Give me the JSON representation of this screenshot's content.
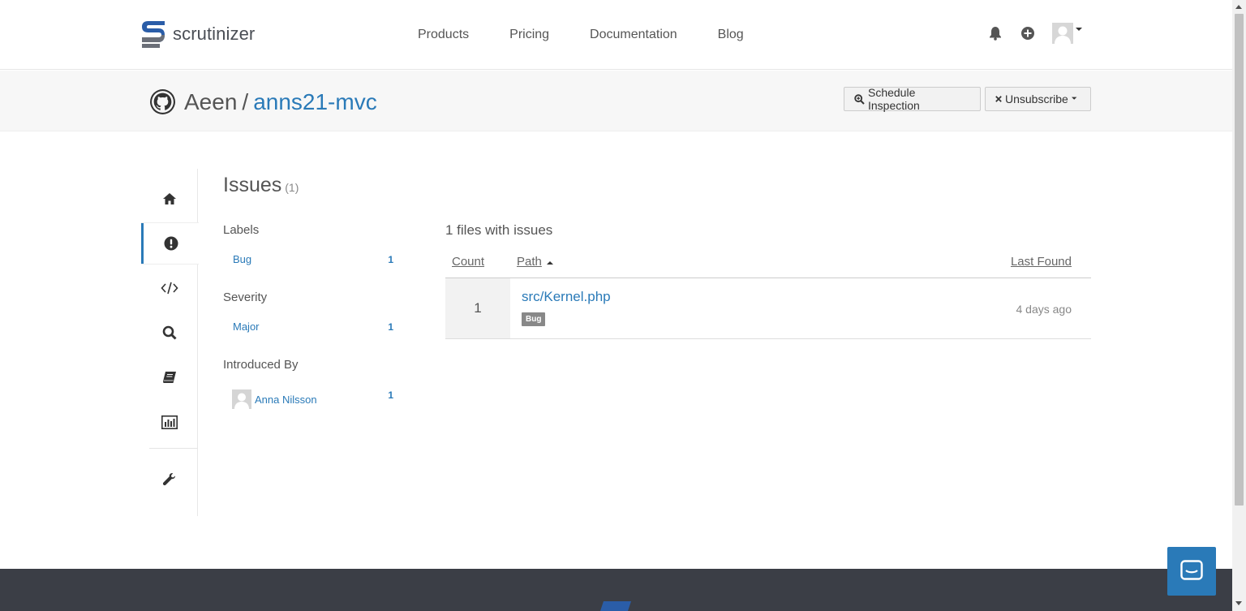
{
  "brand": {
    "name": "scrutinizer",
    "accent": "#2a7ab8"
  },
  "nav": {
    "items": [
      {
        "label": "Products"
      },
      {
        "label": "Pricing"
      },
      {
        "label": "Documentation"
      },
      {
        "label": "Blog"
      }
    ],
    "icons": [
      "bell-icon",
      "plus-circle-icon",
      "user-avatar"
    ]
  },
  "repo": {
    "owner": "Aeen",
    "separator": "/",
    "name": "anns21-mvc",
    "schedule_label": "Schedule Inspection",
    "unsubscribe_label": "Unsubscribe"
  },
  "sidebar": {
    "items": [
      "home-icon",
      "issues-icon",
      "code-icon",
      "search-icon",
      "book-icon",
      "chart-icon",
      "wrench-icon"
    ],
    "active": "issues-icon"
  },
  "issues": {
    "title": "Issues",
    "count": "(1)",
    "facets": {
      "labels": {
        "heading": "Labels",
        "items": [
          {
            "label": "Bug",
            "count": "1"
          }
        ]
      },
      "severity": {
        "heading": "Severity",
        "items": [
          {
            "label": "Major",
            "count": "1"
          }
        ]
      },
      "introduced_by": {
        "heading": "Introduced By",
        "items": [
          {
            "label": "Anna Nilsson",
            "count": "1"
          }
        ]
      }
    },
    "files_heading": "1 files with issues",
    "columns": {
      "count": "Count",
      "path": "Path",
      "last_found": "Last Found"
    },
    "rows": [
      {
        "count": "1",
        "path": "src/Kernel.php",
        "badge": "Bug",
        "last_found": "4 days ago"
      }
    ]
  }
}
